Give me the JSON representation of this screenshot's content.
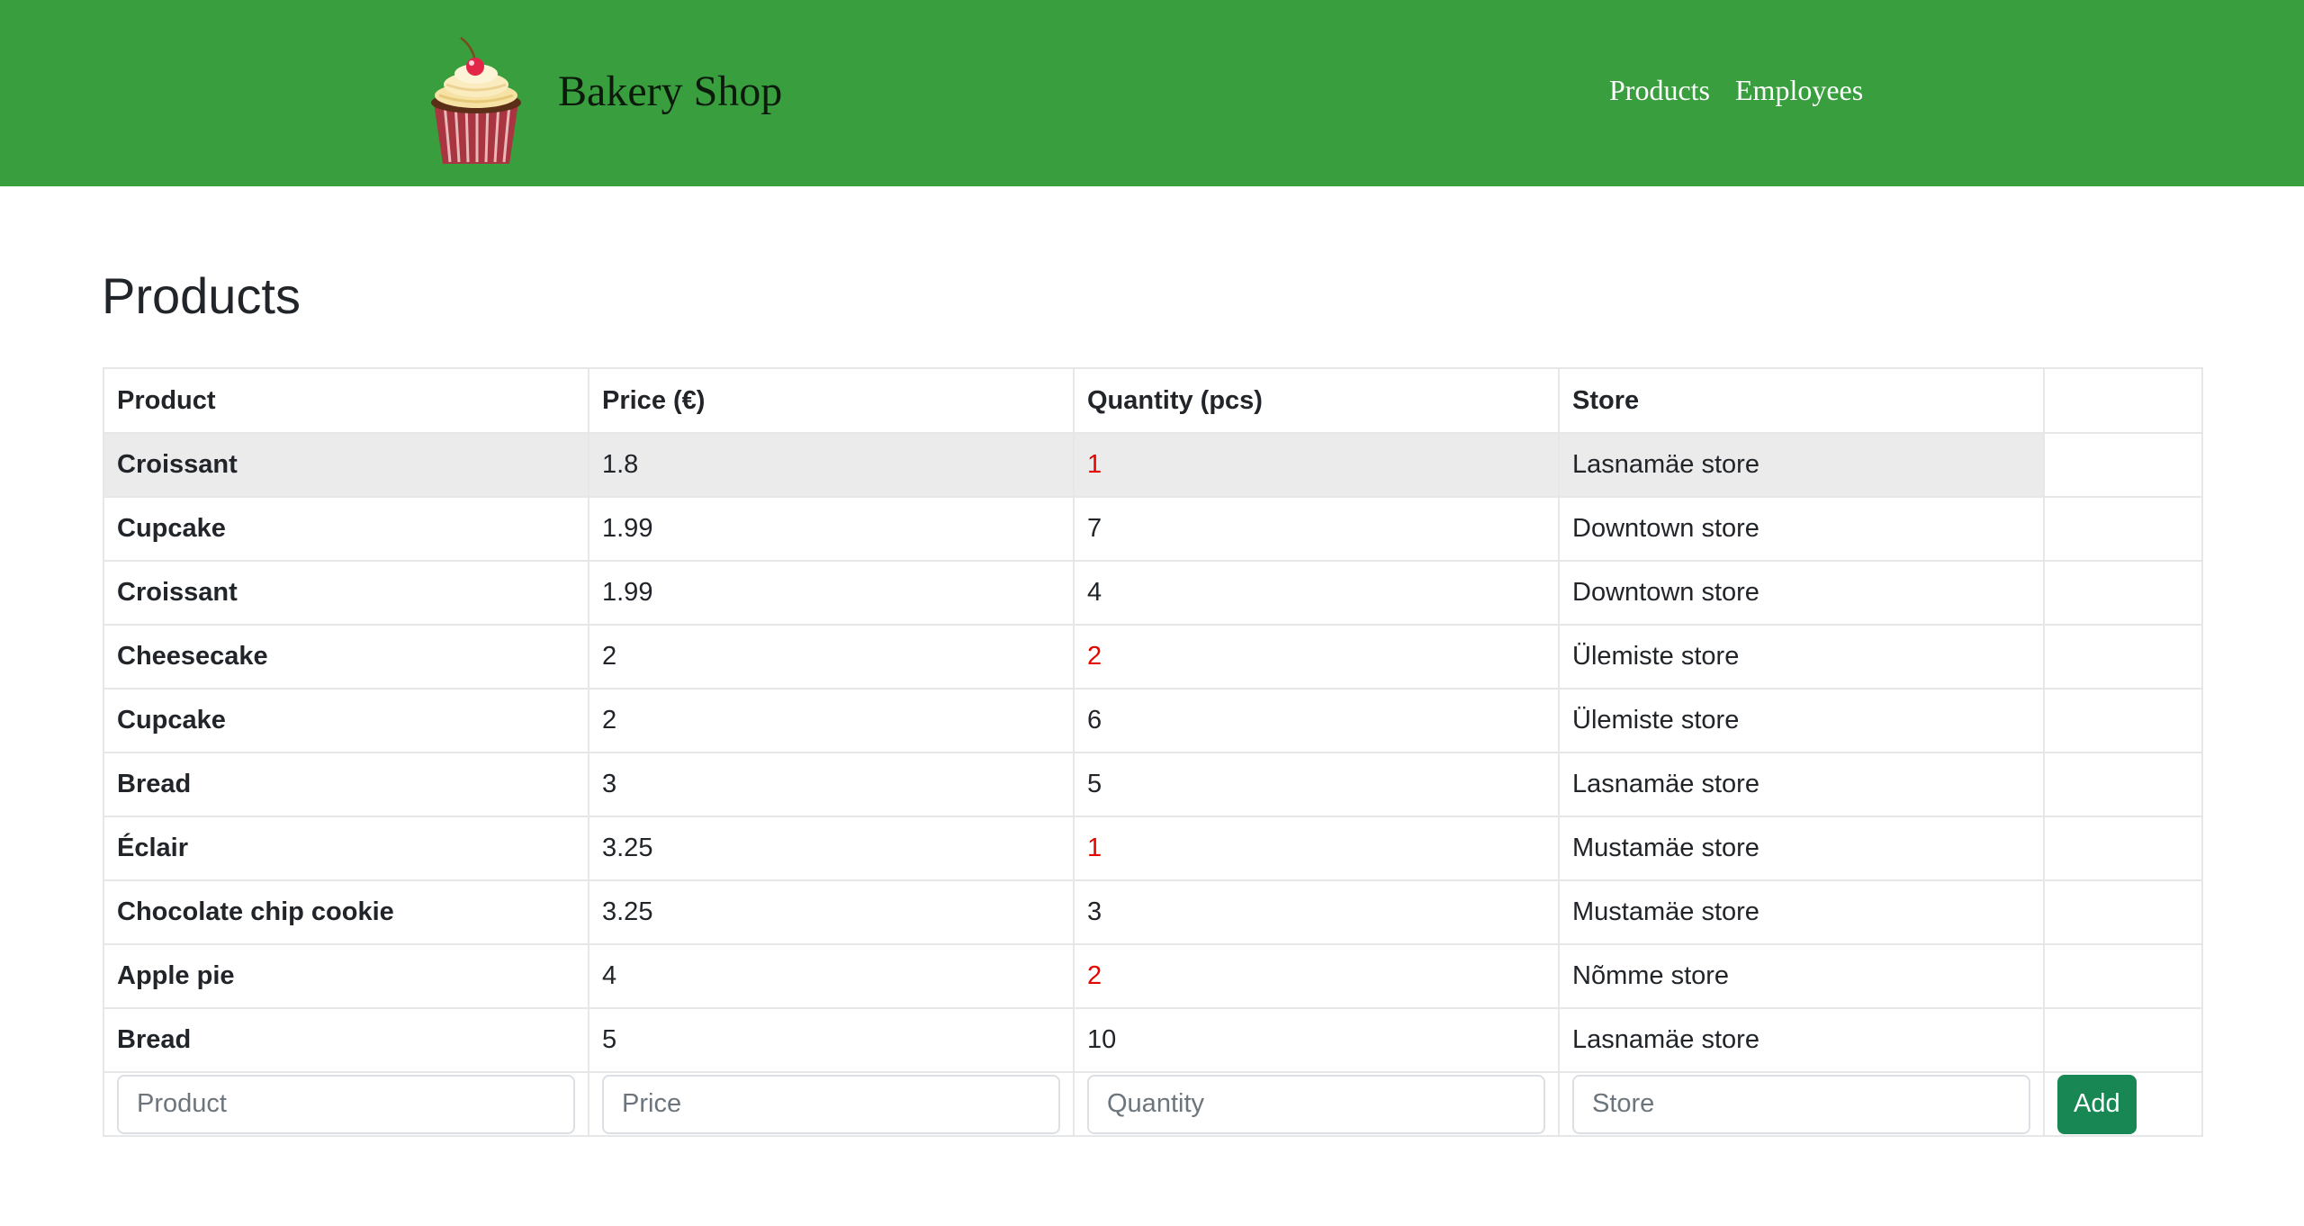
{
  "header": {
    "brand_title": "Bakery Shop",
    "logo_icon": "cupcake-icon",
    "background_color": "#399e3e",
    "nav": [
      {
        "label": "Products"
      },
      {
        "label": "Employees"
      }
    ]
  },
  "main": {
    "title": "Products",
    "table": {
      "columns": [
        "Product",
        "Price (€)",
        "Quantity (pcs)",
        "Store",
        ""
      ],
      "rows": [
        {
          "product": "Croissant",
          "price": "1.8",
          "quantity": "1",
          "store": "Lasnamäe store",
          "low_stock": true,
          "highlighted": true
        },
        {
          "product": "Cupcake",
          "price": "1.99",
          "quantity": "7",
          "store": "Downtown store",
          "low_stock": false,
          "highlighted": false
        },
        {
          "product": "Croissant",
          "price": "1.99",
          "quantity": "4",
          "store": "Downtown store",
          "low_stock": false,
          "highlighted": false
        },
        {
          "product": "Cheesecake",
          "price": "2",
          "quantity": "2",
          "store": "Ülemiste store",
          "low_stock": true,
          "highlighted": false
        },
        {
          "product": "Cupcake",
          "price": "2",
          "quantity": "6",
          "store": "Ülemiste store",
          "low_stock": false,
          "highlighted": false
        },
        {
          "product": "Bread",
          "price": "3",
          "quantity": "5",
          "store": "Lasnamäe store",
          "low_stock": false,
          "highlighted": false
        },
        {
          "product": "Éclair",
          "price": "3.25",
          "quantity": "1",
          "store": "Mustamäe store",
          "low_stock": true,
          "highlighted": false
        },
        {
          "product": "Chocolate chip cookie",
          "price": "3.25",
          "quantity": "3",
          "store": "Mustamäe store",
          "low_stock": false,
          "highlighted": false
        },
        {
          "product": "Apple pie",
          "price": "4",
          "quantity": "2",
          "store": "Nõmme store",
          "low_stock": true,
          "highlighted": false
        },
        {
          "product": "Bread",
          "price": "5",
          "quantity": "10",
          "store": "Lasnamäe store",
          "low_stock": false,
          "highlighted": false
        }
      ],
      "low_stock_color": "#e10600",
      "highlight_color": "#ebebeb"
    },
    "form": {
      "product_placeholder": "Product",
      "price_placeholder": "Price",
      "quantity_placeholder": "Quantity",
      "store_placeholder": "Store",
      "product_value": "",
      "price_value": "",
      "quantity_value": "",
      "store_value": "",
      "add_label": "Add",
      "add_color": "#198754"
    }
  }
}
